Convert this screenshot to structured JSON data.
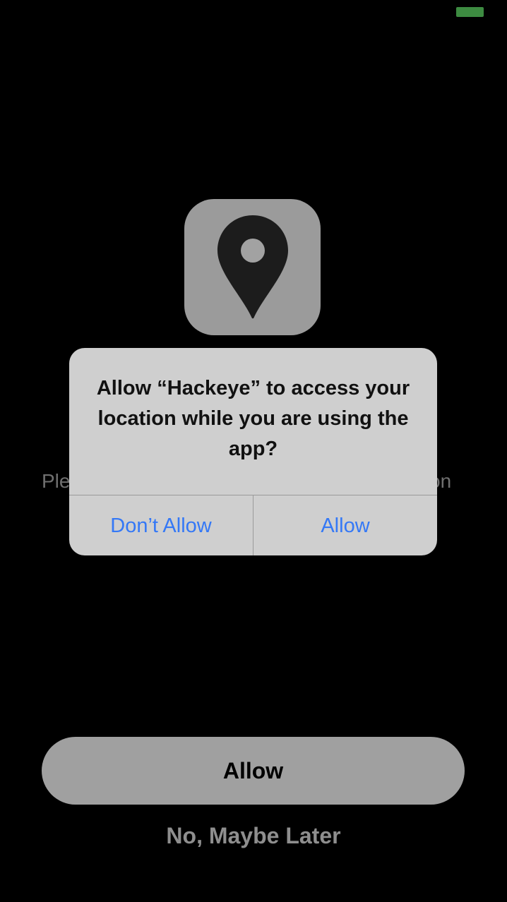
{
  "status_bar": {
    "battery_color": "#3d8b41"
  },
  "screen": {
    "icon": "location-pin-icon",
    "body_text_left": "Ple",
    "body_text_right": "on",
    "allow_button_label": "Allow",
    "later_label": "No, Maybe Later"
  },
  "alert": {
    "message": "Allow “Hackeye” to access your location while you are using the app?",
    "dont_allow_label": "Don’t Allow",
    "allow_label": "Allow",
    "button_color": "#3478f6"
  }
}
